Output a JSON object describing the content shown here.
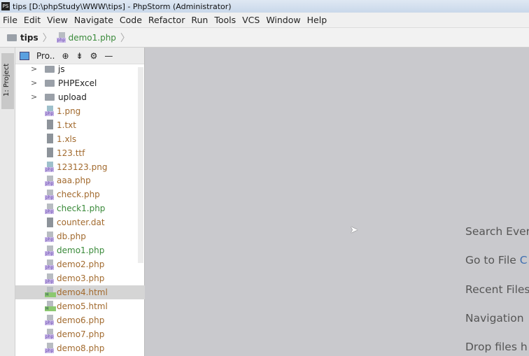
{
  "window": {
    "title": "tips [D:\\phpStudy\\WWW\\tips] - PhpStorm (Administrator)",
    "icon": "PS"
  },
  "menu": [
    "File",
    "Edit",
    "View",
    "Navigate",
    "Code",
    "Refactor",
    "Run",
    "Tools",
    "VCS",
    "Window",
    "Help"
  ],
  "breadcrumb": {
    "folder": "tips",
    "file": "demo1.php"
  },
  "left_strip": {
    "tab": "1: Project"
  },
  "project_panel": {
    "title": "Pro.."
  },
  "tree": [
    {
      "name": "js",
      "type": "dir",
      "status": "dir"
    },
    {
      "name": "PHPExcel",
      "type": "dir",
      "status": "dir"
    },
    {
      "name": "upload",
      "type": "dir",
      "status": "dir"
    },
    {
      "name": "1.png",
      "type": "img",
      "status": "new"
    },
    {
      "name": "1.txt",
      "type": "gen",
      "status": "new"
    },
    {
      "name": "1.xls",
      "type": "gen",
      "status": "new"
    },
    {
      "name": "123.ttf",
      "type": "gen",
      "status": "new"
    },
    {
      "name": "123123.png",
      "type": "img",
      "status": "new"
    },
    {
      "name": "aaa.php",
      "type": "php",
      "status": "new"
    },
    {
      "name": "check.php",
      "type": "php",
      "status": "new"
    },
    {
      "name": "check1.php",
      "type": "php",
      "status": "mod"
    },
    {
      "name": "counter.dat",
      "type": "gen",
      "status": "new"
    },
    {
      "name": "db.php",
      "type": "php",
      "status": "new"
    },
    {
      "name": "demo1.php",
      "type": "php",
      "status": "mod"
    },
    {
      "name": "demo2.php",
      "type": "php",
      "status": "new"
    },
    {
      "name": "demo3.php",
      "type": "php",
      "status": "new"
    },
    {
      "name": "demo4.html",
      "type": "html",
      "status": "new",
      "selected": true
    },
    {
      "name": "demo5.html",
      "type": "html",
      "status": "new"
    },
    {
      "name": "demo6.php",
      "type": "php",
      "status": "new"
    },
    {
      "name": "demo7.php",
      "type": "php",
      "status": "new"
    },
    {
      "name": "demo8.php",
      "type": "php",
      "status": "new"
    }
  ],
  "hints": [
    {
      "label": "Search Ever",
      "shortcut": ""
    },
    {
      "label": "Go to File ",
      "shortcut": "C"
    },
    {
      "label": "Recent Files",
      "shortcut": ""
    },
    {
      "label": "Navigation",
      "shortcut": ""
    },
    {
      "label": "Drop files h",
      "shortcut": ""
    }
  ]
}
